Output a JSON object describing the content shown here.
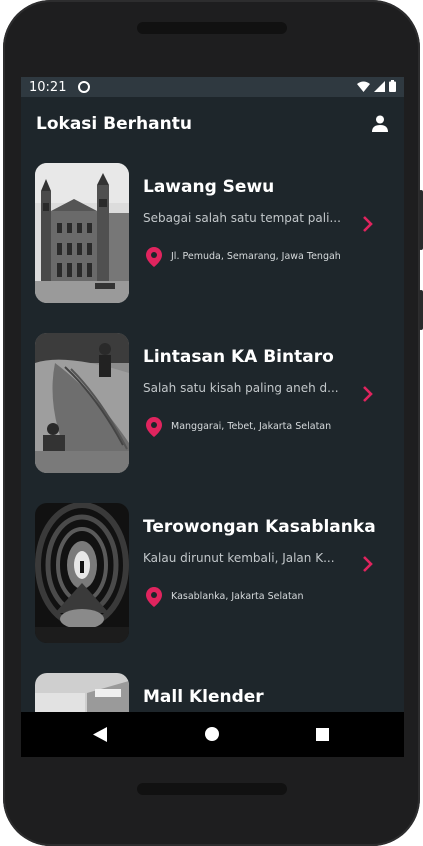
{
  "status_bar": {
    "time": "10:21"
  },
  "app_bar": {
    "title": "Lokasi Berhantu",
    "profile_icon": "person-icon"
  },
  "locations": [
    {
      "title": "Lawang Sewu",
      "description": "Sebagai salah satu tempat pali...",
      "location": "Jl. Pemuda, Semarang, Jawa Tengah"
    },
    {
      "title": "Lintasan KA Bintaro",
      "description": "Salah satu kisah paling aneh d...",
      "location": "Manggarai, Tebet, Jakarta Selatan"
    },
    {
      "title": "Terowongan Kasablanka",
      "description": "Kalau dirunut kembali, Jalan K...",
      "location": "Kasablanka, Jakarta Selatan"
    },
    {
      "title": "Mall Klender",
      "description": "",
      "location": ""
    }
  ],
  "colors": {
    "background": "#1e262b",
    "status_bar": "#2f3940",
    "accent": "#e0245e"
  }
}
